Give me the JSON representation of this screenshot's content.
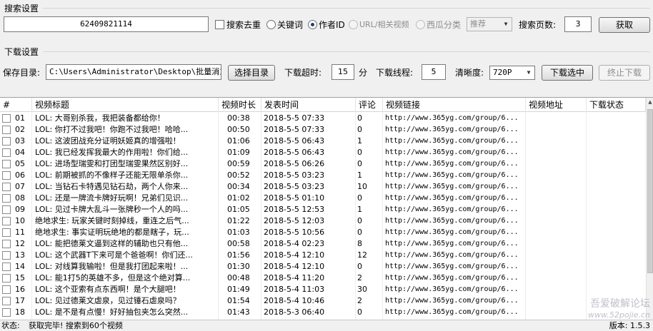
{
  "search_group": {
    "title": "搜索设置",
    "query_value": "62409821114",
    "dedup_label": "搜索去重",
    "mode_keyword": "关键词",
    "mode_author": "作者ID",
    "mode_url": "URL/相关视频",
    "mode_category": "西瓜分类",
    "sort_selected": "推荐",
    "pages_label": "搜索页数:",
    "pages_value": "3",
    "fetch_button": "获取"
  },
  "download_group": {
    "title": "下载设置",
    "dir_label": "保存目录:",
    "dir_value": "C:\\Users\\Administrator\\Desktop\\批量消重\\",
    "choose_dir_button": "选择目录",
    "timeout_label": "下载超时:",
    "timeout_value": "15",
    "timeout_unit": "分",
    "threads_label": "下载线程:",
    "threads_value": "5",
    "quality_label": "清晰度:",
    "quality_selected": "720P",
    "download_selected_button": "下载选中",
    "stop_download_button": "终止下载"
  },
  "table": {
    "headers": [
      "#",
      "视频标题",
      "视频时长",
      "发表时间",
      "评论",
      "视频链接",
      "视频地址",
      "下载状态"
    ],
    "rows": [
      {
        "no": "01",
        "title": "LOL: 大哥别杀我，我把装备都给你！",
        "duration": "00:38",
        "time": "2018-5-5 07:33",
        "comments": "0",
        "link": "http://www.365yg.com/group/6..."
      },
      {
        "no": "02",
        "title": "LOL: 你打不过我吧！你跑不过我吧！哈哈...",
        "duration": "00:50",
        "time": "2018-5-5 07:33",
        "comments": "0",
        "link": "http://www.365yg.com/group/6..."
      },
      {
        "no": "03",
        "title": "LOL: 这波团战充分证明妖姬真的增强啦！",
        "duration": "01:06",
        "time": "2018-5-5 06:43",
        "comments": "1",
        "link": "http://www.365yg.com/group/6..."
      },
      {
        "no": "04",
        "title": "LOL: 我已经发挥我最大的作用啦！你们给...",
        "duration": "01:09",
        "time": "2018-5-5 06:43",
        "comments": "0",
        "link": "http://www.365yg.com/group/6..."
      },
      {
        "no": "05",
        "title": "LOL: 进场型瑞雯和打团型瑞雯果然区别好...",
        "duration": "00:59",
        "time": "2018-5-5 06:26",
        "comments": "0",
        "link": "http://www.365yg.com/group/6..."
      },
      {
        "no": "06",
        "title": "LOL: 前期被抓的不像样子还能无限单杀你...",
        "duration": "00:52",
        "time": "2018-5-5 03:23",
        "comments": "1",
        "link": "http://www.365yg.com/group/6..."
      },
      {
        "no": "07",
        "title": "LOL: 当钻石卡特遇见钻石劫，两个人你来...",
        "duration": "00:34",
        "time": "2018-5-5 03:23",
        "comments": "10",
        "link": "http://www.365yg.com/group/6..."
      },
      {
        "no": "08",
        "title": "LOL: 还是一牌流卡牌好玩啊！兄弟们见识...",
        "duration": "01:02",
        "time": "2018-5-5 01:10",
        "comments": "0",
        "link": "http://www.365yg.com/group/6..."
      },
      {
        "no": "09",
        "title": "LOL: 见过卡牌大乱斗一张牌秒一个人的吗...",
        "duration": "01:05",
        "time": "2018-5-5 12:53",
        "comments": "1",
        "link": "http://www.365yg.com/group/6..."
      },
      {
        "no": "10",
        "title": "绝地求生: 玩家关键时刻掉线，重连之后气...",
        "duration": "01:22",
        "time": "2018-5-5 12:03",
        "comments": "0",
        "link": "http://www.365yg.com/group/6..."
      },
      {
        "no": "11",
        "title": "绝地求生: 事实证明玩绝地的都是瞎子，玩...",
        "duration": "01:03",
        "time": "2018-5-5 10:56",
        "comments": "0",
        "link": "http://www.365yg.com/group/6..."
      },
      {
        "no": "12",
        "title": "LOL: 能把德莱文逼到这样的辅助也只有他...",
        "duration": "00:58",
        "time": "2018-5-4 02:23",
        "comments": "8",
        "link": "http://www.365yg.com/group/6..."
      },
      {
        "no": "13",
        "title": "LOL: 这个武器T下来可是个爸爸啊！你们还...",
        "duration": "01:56",
        "time": "2018-5-4 12:10",
        "comments": "12",
        "link": "http://www.365yg.com/group/6..."
      },
      {
        "no": "14",
        "title": "LOL: 对线算我输啦！但是我打团起来啦！...",
        "duration": "01:30",
        "time": "2018-5-4 12:10",
        "comments": "0",
        "link": "http://www.365yg.com/group/6..."
      },
      {
        "no": "15",
        "title": "LOL: 能1打5的英雄不多，但是这个绝对算...",
        "duration": "00:48",
        "time": "2018-5-4 11:20",
        "comments": "2",
        "link": "http://www.365yg.com/group/6..."
      },
      {
        "no": "16",
        "title": "LOL: 这个亚索有点东西啊！是个大腿吧！",
        "duration": "01:49",
        "time": "2018-5-4 11:03",
        "comments": "30",
        "link": "http://www.365yg.com/group/6..."
      },
      {
        "no": "17",
        "title": "LOL: 见过德莱文虐泉，见过锤石虐泉吗？",
        "duration": "01:54",
        "time": "2018-5-4 10:46",
        "comments": "2",
        "link": "http://www.365yg.com/group/6..."
      },
      {
        "no": "18",
        "title": "LOL: 是不是有点慢！好好抽包夹怎么突然...",
        "duration": "01:43",
        "time": "2018-5-3 06:40",
        "comments": "0",
        "link": "http://www.365yg.com/group/6..."
      }
    ]
  },
  "status_bar": {
    "label": "状态:",
    "message": "获取完毕! 搜索到60个视频",
    "version": "版本: 1.5.3"
  },
  "watermark": {
    "line1": "吾爱破解论坛",
    "line2": "www.52pojie.cn"
  },
  "icons": {
    "dropdown": "chevron-down-icon",
    "scroll_up": "chevron-up-icon"
  },
  "colors": {
    "window_bg": "#f0f0f0",
    "table_bg": "#ffffff",
    "radio_dot": "#1e3d7a"
  }
}
